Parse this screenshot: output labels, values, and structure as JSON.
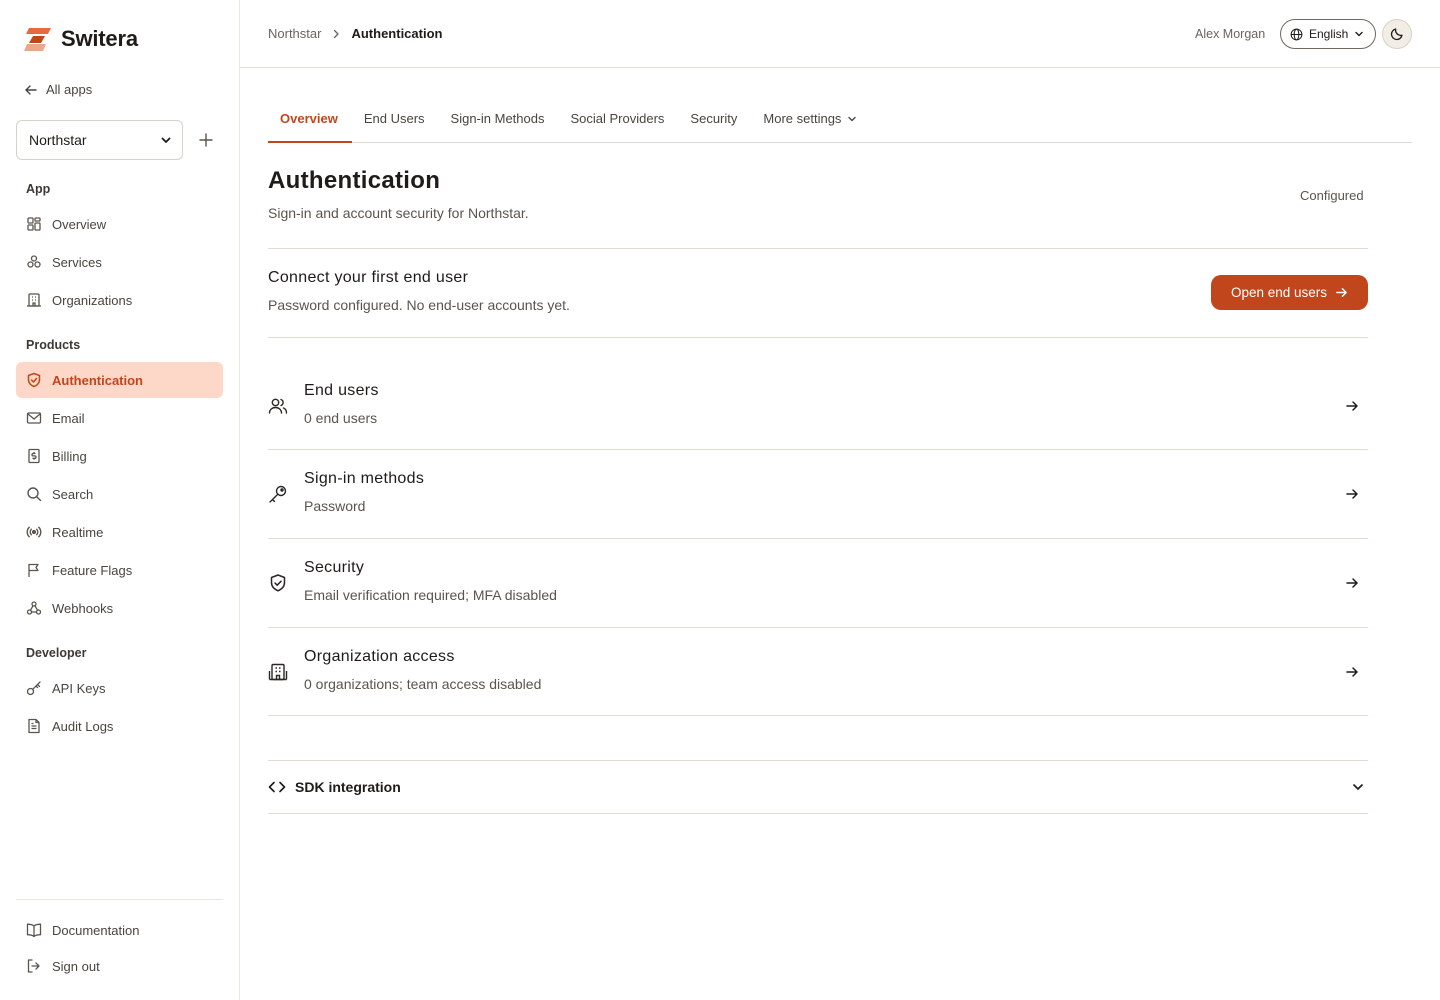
{
  "brand": {
    "name": "Switera"
  },
  "sidebar": {
    "back_label": "All apps",
    "app_selector": {
      "value": "Northstar"
    },
    "sections": {
      "app": "App",
      "products": "Products",
      "developer": "Developer"
    },
    "app_items": [
      {
        "label": "Overview",
        "icon": "grid-icon"
      },
      {
        "label": "Services",
        "icon": "services-icon"
      },
      {
        "label": "Organizations",
        "icon": "building-icon"
      }
    ],
    "product_items": [
      {
        "label": "Authentication",
        "icon": "shield-icon",
        "active": true
      },
      {
        "label": "Email",
        "icon": "mail-icon"
      },
      {
        "label": "Billing",
        "icon": "billing-icon"
      },
      {
        "label": "Search",
        "icon": "search-icon"
      },
      {
        "label": "Realtime",
        "icon": "broadcast-icon"
      },
      {
        "label": "Feature Flags",
        "icon": "flag-icon"
      },
      {
        "label": "Webhooks",
        "icon": "webhook-icon"
      }
    ],
    "developer_items": [
      {
        "label": "API Keys",
        "icon": "key-icon"
      },
      {
        "label": "Audit Logs",
        "icon": "file-icon"
      }
    ],
    "footer_items": [
      {
        "label": "Documentation",
        "icon": "book-icon"
      },
      {
        "label": "Sign out",
        "icon": "sign-out-icon"
      }
    ]
  },
  "header": {
    "breadcrumb": {
      "parent": "Northstar",
      "current": "Authentication"
    },
    "user_name": "Alex Morgan",
    "language": "English"
  },
  "tabs": [
    {
      "label": "Overview",
      "active": true
    },
    {
      "label": "End Users"
    },
    {
      "label": "Sign-in Methods"
    },
    {
      "label": "Social Providers"
    },
    {
      "label": "Security"
    },
    {
      "label": "More settings",
      "dropdown": true
    }
  ],
  "main": {
    "title": "Authentication",
    "subtitle": "Sign-in and account security for Northstar.",
    "status": "Configured",
    "cta": {
      "title": "Connect your first end user",
      "description": "Password configured. No end-user accounts yet.",
      "button_label": "Open end users"
    },
    "rows": [
      {
        "title": "End users",
        "description": "0 end users",
        "icon": "users-icon"
      },
      {
        "title": "Sign-in methods",
        "description": "Password",
        "icon": "key-icon"
      },
      {
        "title": "Security",
        "description": "Email verification required; MFA disabled",
        "icon": "shield-check-icon"
      },
      {
        "title": "Organization access",
        "description": "0 organizations; team access disabled",
        "icon": "building-icon"
      }
    ],
    "sdk": {
      "title": "SDK integration",
      "icon": "code-icon"
    }
  },
  "colors": {
    "accent": "#c2461c",
    "active_bg": "#fdd8c8",
    "border": "#e2dcd2"
  }
}
